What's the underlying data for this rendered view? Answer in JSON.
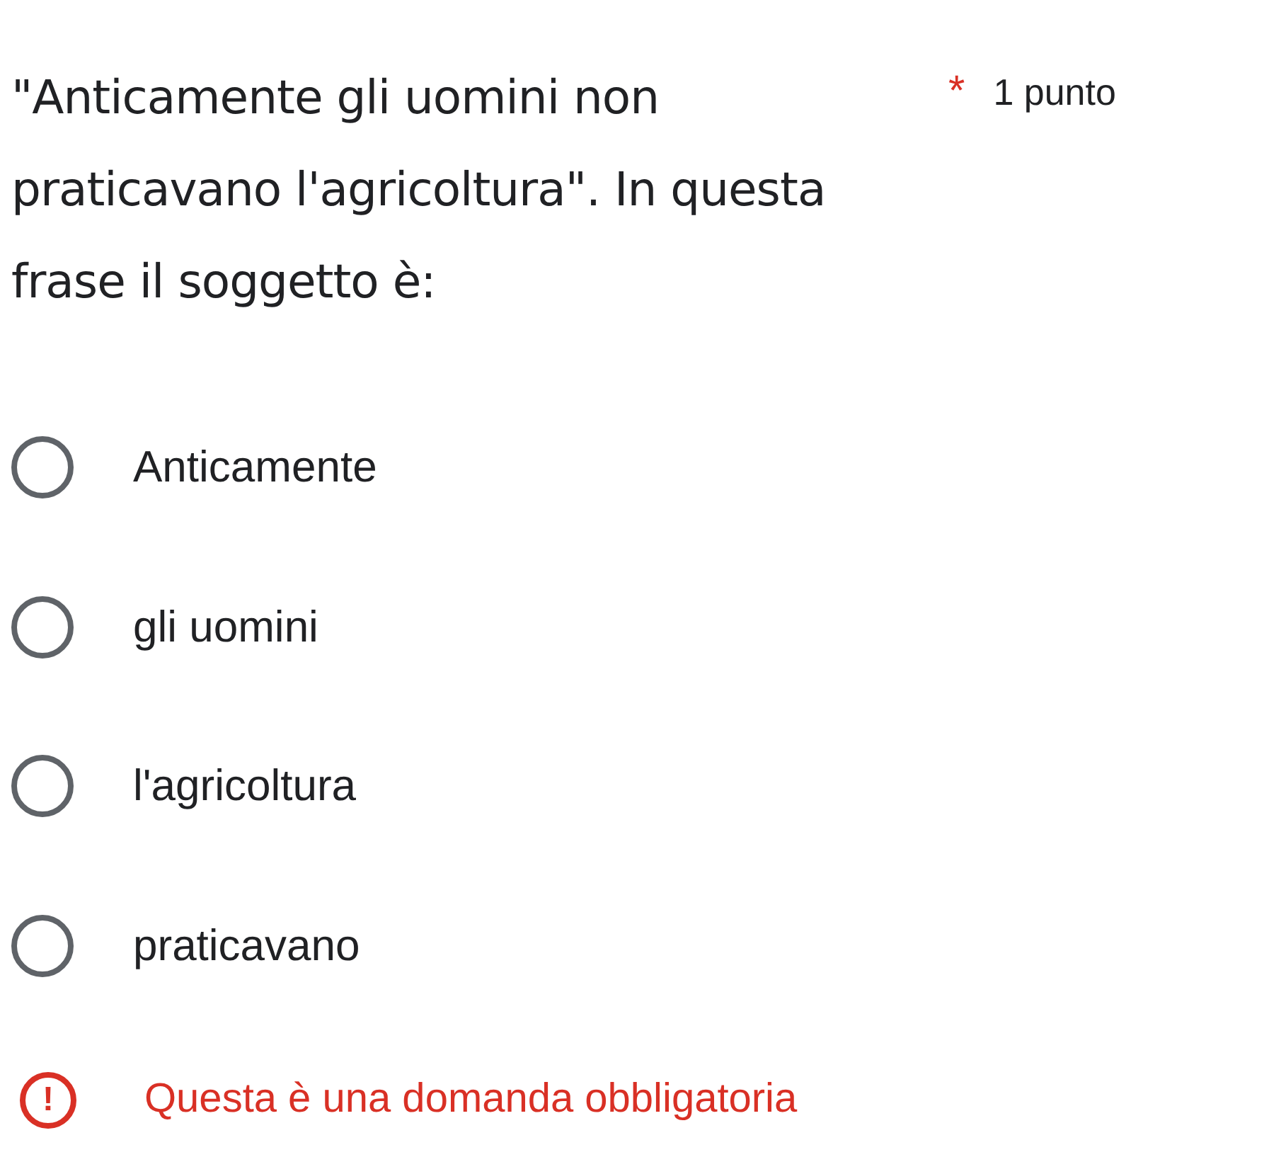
{
  "question": {
    "text": "\"Anticamente gli uomini non praticavano l'agricoltura\". In questa frase il soggetto è:",
    "required_mark": "*",
    "points": "1 punto"
  },
  "options": [
    {
      "label": "Anticamente",
      "selected": false
    },
    {
      "label": "gli uomini",
      "selected": false
    },
    {
      "label": "l'agricoltura",
      "selected": false
    },
    {
      "label": "praticavano",
      "selected": false
    }
  ],
  "error": {
    "icon": "!",
    "message": "Questa è una domanda obbligatoria"
  }
}
